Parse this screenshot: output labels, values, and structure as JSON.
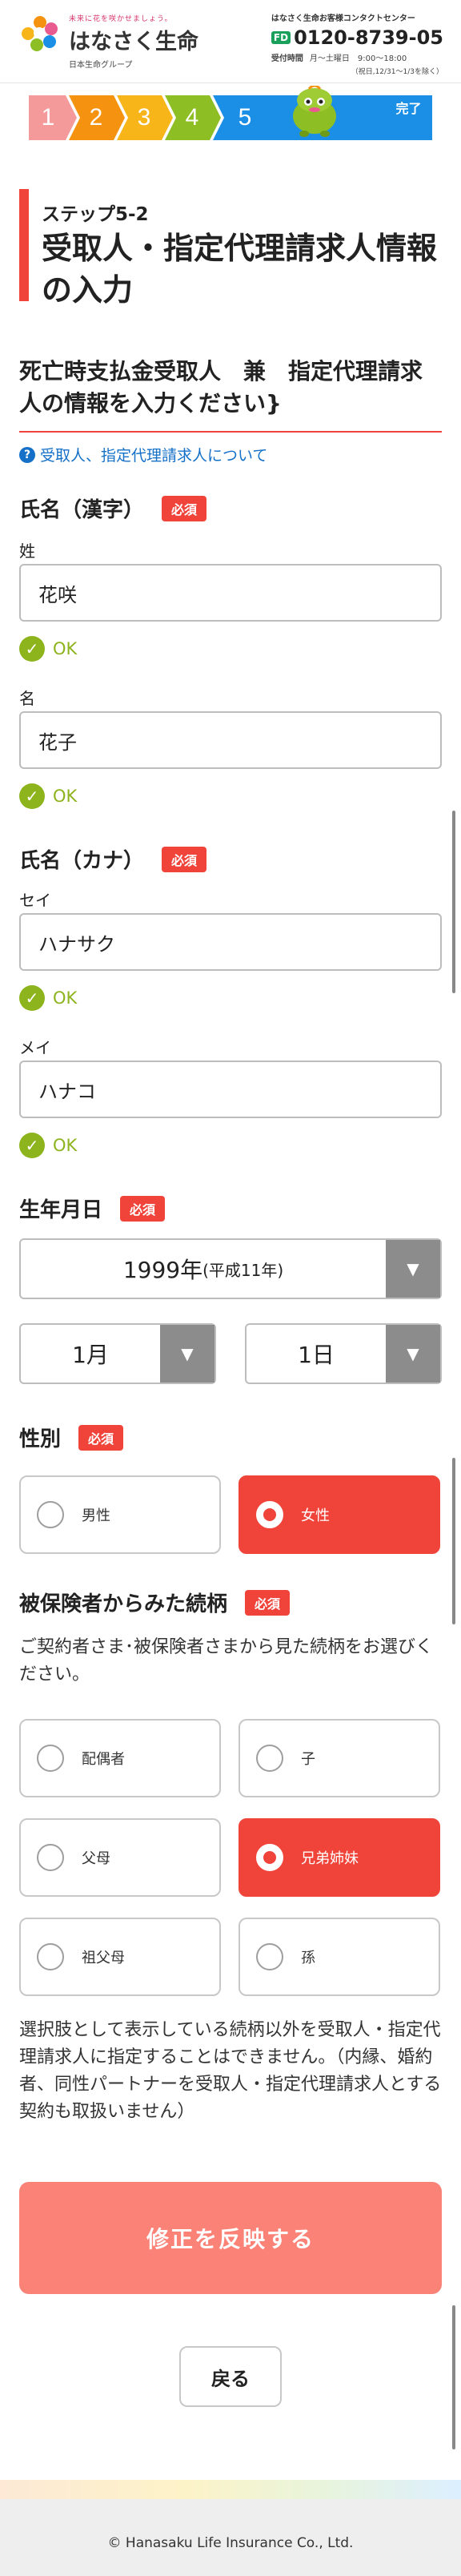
{
  "header": {
    "tagline": "未来に花を咲かせましょう。",
    "brand": "はなさく生命",
    "group": "日本生命グループ",
    "contact_title": "はなさく生命お客様コンタクトセンター",
    "freedial": "FD",
    "phone": "0120-8739-05",
    "hours_label": "受付時間",
    "hours": "月～土曜日　9:00～18:00",
    "holiday": "（祝日,12/31～1/3を除く）"
  },
  "steps": {
    "items": [
      "1",
      "2",
      "3",
      "4",
      "5"
    ],
    "done": "完了",
    "current": 5,
    "colors": [
      "#f59a9a",
      "#f5920f",
      "#f7b51a",
      "#8dbf25",
      "#1b8fe5",
      "#1b8fe5"
    ]
  },
  "page": {
    "step_label": "ステップ5-2",
    "title": "受取人・指定代理請求人情報の入力",
    "section_title": "死亡時支払金受取人　兼　指定代理請求人の情報を入力ください}",
    "help_icon": "?",
    "help_link": "受取人、指定代理請求人について"
  },
  "form": {
    "required_label": "必須",
    "ok_label": "OK",
    "name_kanji": {
      "label": "氏名（漢字）",
      "sei_label": "姓",
      "sei_value": "花咲",
      "mei_label": "名",
      "mei_value": "花子"
    },
    "name_kana": {
      "label": "氏名（カナ）",
      "sei_label": "セイ",
      "sei_value": "ハナサク",
      "mei_label": "メイ",
      "mei_value": "ハナコ"
    },
    "birthdate": {
      "label": "生年月日",
      "year": "1999年",
      "era": "(平成11年)",
      "month": "1月",
      "day": "1日"
    },
    "gender": {
      "label": "性別",
      "options": [
        "男性",
        "女性"
      ],
      "selected": "女性"
    },
    "relation": {
      "label": "被保険者からみた続柄",
      "instruction": "ご契約者さま･被保険者さまから見た続柄をお選びください。",
      "options": [
        "配偶者",
        "子",
        "父母",
        "兄弟姉妹",
        "祖父母",
        "孫"
      ],
      "selected": "兄弟姉妹",
      "note": "選択肢として表示している続柄以外を受取人・指定代理請求人に指定することはできません。（内縁、婚約者、同性パートナーを受取人・指定代理請求人とする契約も取扱いません）"
    }
  },
  "actions": {
    "submit": "修正を反映する",
    "back": "戻る"
  },
  "footer": {
    "copyright": "© Hanasaku Life Insurance Co., Ltd."
  }
}
